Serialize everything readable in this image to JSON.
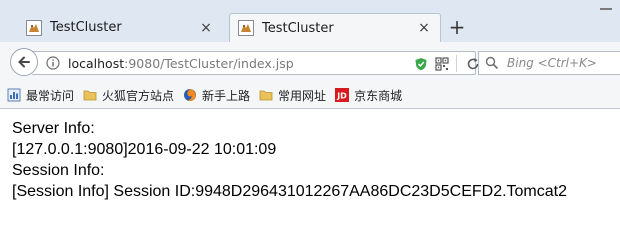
{
  "tabs": [
    {
      "title": "TestCluster",
      "active": false
    },
    {
      "title": "TestCluster",
      "active": true
    }
  ],
  "new_tab_label": "+",
  "close_glyph": "×",
  "navbar": {
    "url_host": "localhost",
    "url_rest": ":9080/TestCluster/index.jsp",
    "search_placeholder": "Bing <Ctrl+K>"
  },
  "bookmarks": [
    {
      "label": "最常访问",
      "icon": "most-visited-icon"
    },
    {
      "label": "火狐官方站点",
      "icon": "folder-icon"
    },
    {
      "label": "新手上路",
      "icon": "firefox-icon"
    },
    {
      "label": "常用网址",
      "icon": "folder-icon"
    },
    {
      "label": "京东商城",
      "icon": "jd-icon"
    }
  ],
  "jd_badge": "JD",
  "page": {
    "line1": "Server Info:",
    "line2": "[127.0.0.1:9080]2016-09-22 10:01:09",
    "line3": "Session Info:",
    "line4": "[Session Info] Session ID:9948D296431012267AA86DC23D5CEFD2.Tomcat2"
  },
  "colors": {
    "tabstrip_bg": "#dfe7f2",
    "toolbar_bg": "#f5f6f7",
    "shield_green": "#3aa84a",
    "jd_red": "#d71920",
    "folder_yellow": "#e9c25a"
  }
}
